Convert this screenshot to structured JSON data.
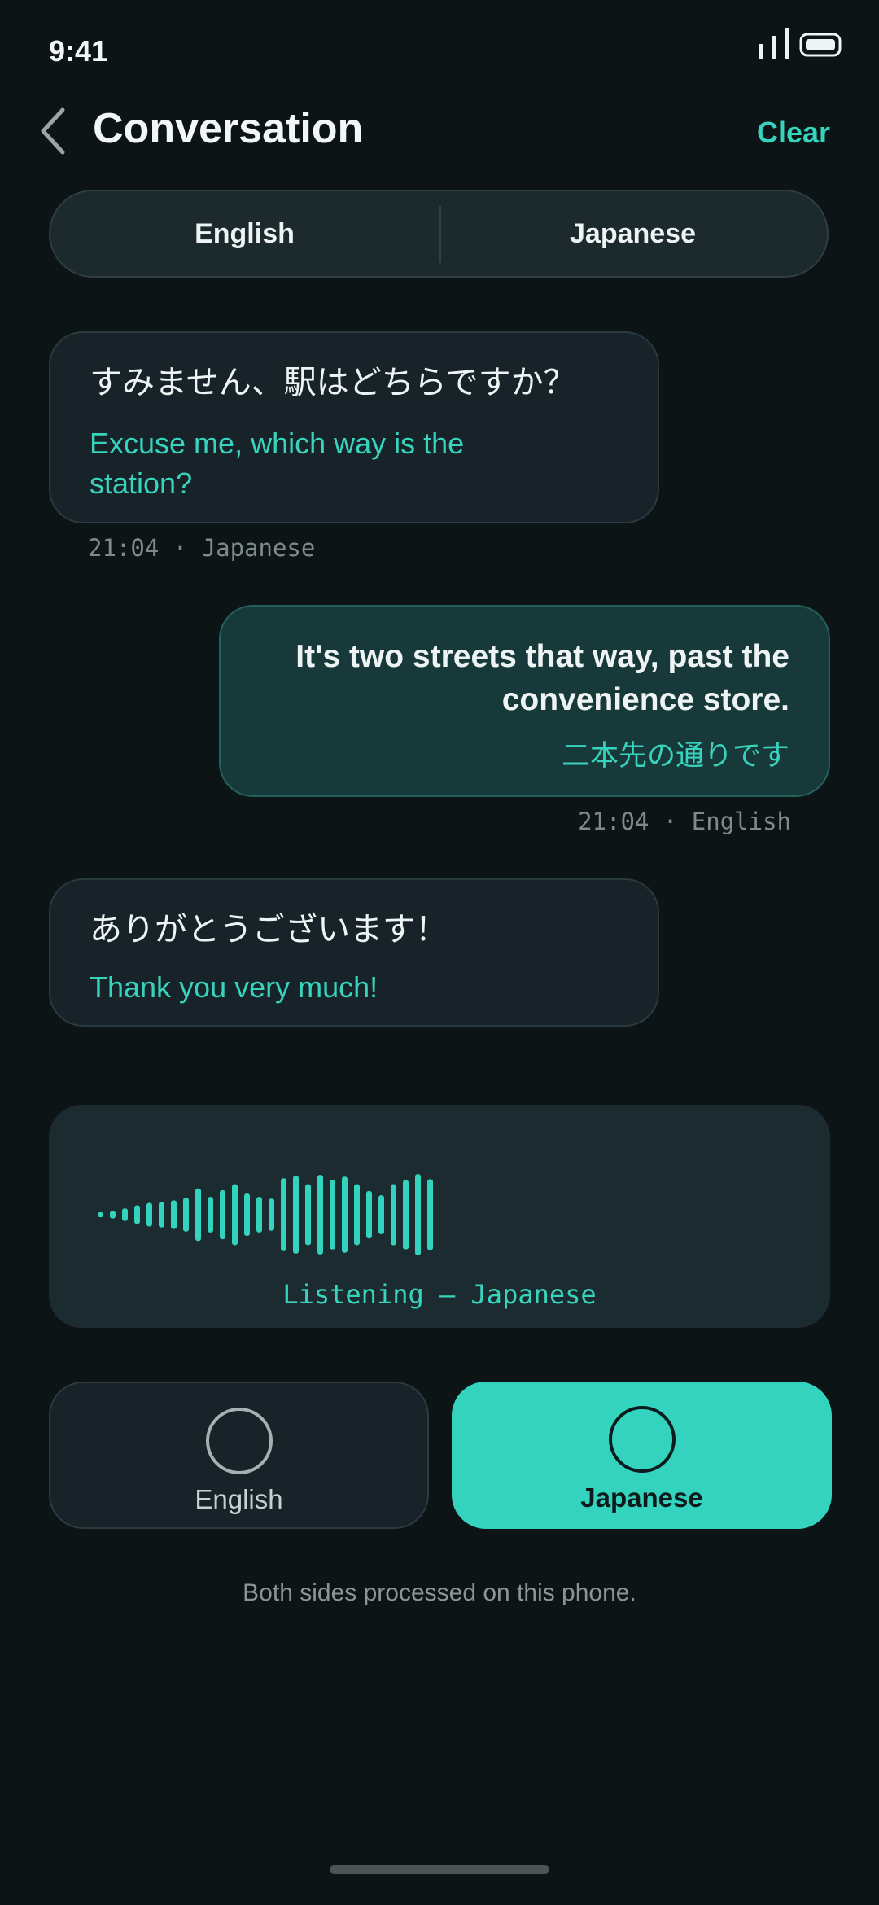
{
  "status_bar": {
    "time": "9:41"
  },
  "header": {
    "title": "Conversation",
    "clear_label": "Clear"
  },
  "language_toggle": {
    "left": "English",
    "right": "Japanese"
  },
  "messages": [
    {
      "original": "すみません、駅はどちらですか？",
      "translation": "Excuse me, which way is the station?",
      "time": "21:04",
      "language": "Japanese",
      "meta": "21:04 · Japanese",
      "side": "incoming"
    },
    {
      "original": "It's two streets that way, past the convenience store.",
      "translation": "二本先の通りです",
      "time": "21:04",
      "language": "English",
      "meta": "21:04 · English",
      "side": "outgoing"
    },
    {
      "original": "ありがとうございます！",
      "translation": "Thank you very much!",
      "side": "incoming"
    }
  ],
  "listening": {
    "label": "Listening — Japanese",
    "waveform_levels": [
      0.06,
      0.09,
      0.15,
      0.22,
      0.28,
      0.3,
      0.34,
      0.4,
      0.62,
      0.42,
      0.58,
      0.72,
      0.5,
      0.42,
      0.38,
      0.86,
      0.92,
      0.72,
      0.94,
      0.82,
      0.9,
      0.72,
      0.56,
      0.46,
      0.72,
      0.82,
      0.96,
      0.84,
      0.88,
      0.92,
      0.96,
      0.88
    ]
  },
  "mic_buttons": [
    {
      "label": "English",
      "active": false
    },
    {
      "label": "Japanese",
      "active": true
    }
  ],
  "footer_note": "Both sides processed on this phone.",
  "colors": {
    "accent": "#33d3bd",
    "background": "#0c1416",
    "outgoing_bubble": "#18393a"
  }
}
